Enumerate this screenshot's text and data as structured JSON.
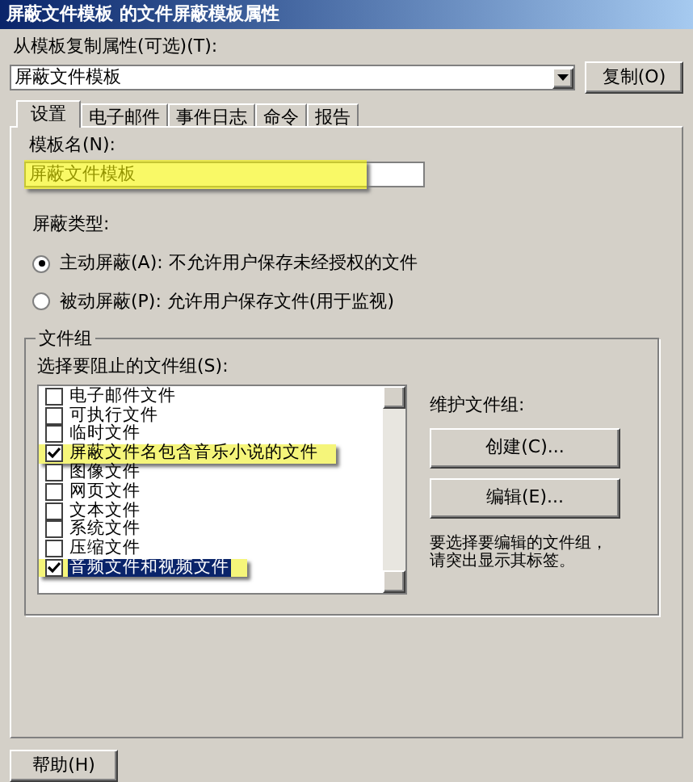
{
  "window": {
    "title": "屏蔽文件模板 的文件屏蔽模板属性"
  },
  "copy_from": {
    "label": "从模板复制属性(可选)(T):",
    "value": "屏蔽文件模板",
    "button": "复制(O)"
  },
  "tabs": [
    {
      "label": "设置",
      "selected": true
    },
    {
      "label": "电子邮件",
      "selected": false
    },
    {
      "label": "事件日志",
      "selected": false
    },
    {
      "label": "命令",
      "selected": false
    },
    {
      "label": "报告",
      "selected": false
    }
  ],
  "template_name": {
    "label": "模板名(N):",
    "value": "屏蔽文件模板",
    "highlighted": true
  },
  "screening_type": {
    "label": "屏蔽类型:",
    "options": [
      {
        "label": "主动屏蔽(A): 不允许用户保存未经授权的文件",
        "selected": true
      },
      {
        "label": "被动屏蔽(P): 允许用户保存文件(用于监视)",
        "selected": false
      }
    ]
  },
  "file_groups": {
    "title": "文件组",
    "list_label": "选择要阻止的文件组(S):",
    "items": [
      {
        "label": "电子邮件文件",
        "checked": false,
        "selected": false,
        "highlighted": false
      },
      {
        "label": "可执行文件",
        "checked": false,
        "selected": false,
        "highlighted": false
      },
      {
        "label": "临时文件",
        "checked": false,
        "selected": false,
        "highlighted": false
      },
      {
        "label": "屏蔽文件名包含音乐小说的文件",
        "checked": true,
        "selected": false,
        "highlighted": true
      },
      {
        "label": "图像文件",
        "checked": false,
        "selected": false,
        "highlighted": false
      },
      {
        "label": "网页文件",
        "checked": false,
        "selected": false,
        "highlighted": false
      },
      {
        "label": "文本文件",
        "checked": false,
        "selected": false,
        "highlighted": false
      },
      {
        "label": "系统文件",
        "checked": false,
        "selected": false,
        "highlighted": false
      },
      {
        "label": "压缩文件",
        "checked": false,
        "selected": false,
        "highlighted": false
      },
      {
        "label": "音频文件和视频文件",
        "checked": true,
        "selected": true,
        "highlighted": true
      }
    ],
    "maintain_label": "维护文件组:",
    "buttons": [
      "创建(C)...",
      "编辑(E)..."
    ],
    "hint": "要选择要编辑的文件组，请突出显示其标签。"
  },
  "footer": {
    "buttons": [
      "帮助(H)"
    ]
  }
}
